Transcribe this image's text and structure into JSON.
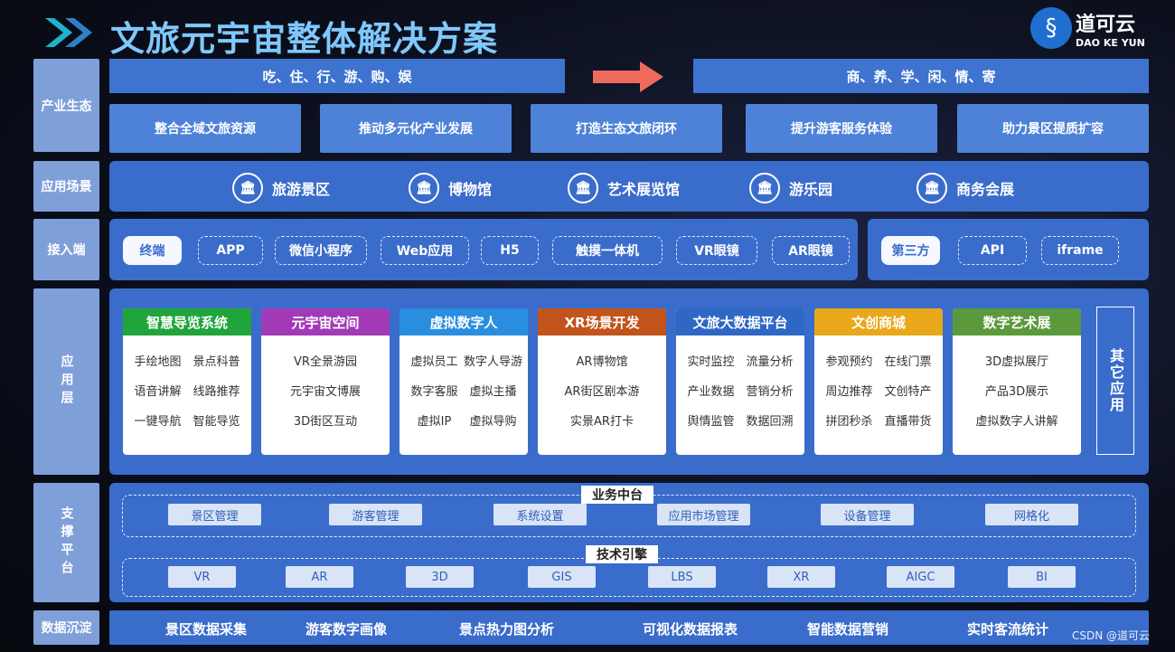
{
  "header": {
    "title": "文旅元宇宙整体解决方案",
    "logo_name": "道可云",
    "logo_sub": "DAO KE YUN"
  },
  "rows": {
    "industry": "产业生态",
    "scene": "应用场景",
    "access": "接入端",
    "app": "应用层",
    "support": "支撑平台",
    "data": "数据沉淀"
  },
  "industry": {
    "left": "吃、住、行、游、购、娱",
    "right": "商、养、学、闲、情、寄",
    "boxes": [
      "整合全域文旅资源",
      "推动多元化产业发展",
      "打造生态文旅闭环",
      "提升游客服务体验",
      "助力景区提质扩容"
    ]
  },
  "scenes": [
    "旅游景区",
    "博物馆",
    "艺术展览馆",
    "游乐园",
    "商务会展"
  ],
  "access": {
    "terminal_label": "终端",
    "terminals": [
      "APP",
      "微信小程序",
      "Web应用",
      "H5",
      "触摸一体机",
      "VR眼镜",
      "AR眼镜"
    ],
    "third_label": "第三方",
    "third": [
      "API",
      "iframe"
    ]
  },
  "apps": [
    {
      "title": "智慧导览系统",
      "color": "#1fa53a",
      "items": [
        "手绘地图",
        "景点科普",
        "语音讲解",
        "线路推荐",
        "一键导航",
        "智能导览"
      ]
    },
    {
      "title": "元宇宙空间",
      "color": "#a23ab8",
      "items": [
        "VR全景游园",
        "元宇宙文博展",
        "3D街区互动"
      ]
    },
    {
      "title": "虚拟数字人",
      "color": "#2a8ee0",
      "items": [
        "虚拟员工",
        "数字人导游",
        "数字客服",
        "虚拟主播",
        "虚拟IP",
        "虚拟导购"
      ]
    },
    {
      "title": "XR场景开发",
      "color": "#c2531a",
      "items": [
        "AR博物馆",
        "AR街区剧本游",
        "实景AR打卡"
      ]
    },
    {
      "title": "文旅大数据平台",
      "color": "#2f67c4",
      "items": [
        "实时监控",
        "流量分析",
        "产业数据",
        "营销分析",
        "舆情监管",
        "数据回溯"
      ]
    },
    {
      "title": "文创商城",
      "color": "#e8a81a",
      "items": [
        "参观预约",
        "在线门票",
        "周边推荐",
        "文创特产",
        "拼团秒杀",
        "直播带货"
      ]
    },
    {
      "title": "数字艺术展",
      "color": "#5b9a3c",
      "items": [
        "3D虚拟展厅",
        "产品3D展示",
        "虚拟数字人讲解"
      ]
    }
  ],
  "other_app": "其它应用",
  "support": {
    "business_title": "业务中台",
    "business": [
      "景区管理",
      "游客管理",
      "系统设置",
      "应用市场管理",
      "设备管理",
      "网格化"
    ],
    "tech_title": "技术引擎",
    "tech": [
      "VR",
      "AR",
      "3D",
      "GIS",
      "LBS",
      "XR",
      "AIGC",
      "BI"
    ]
  },
  "data_items": [
    "景区数据采集",
    "游客数字画像",
    "景点热力图分析",
    "可视化数据报表",
    "智能数据营销",
    "实时客流统计"
  ],
  "watermark": "CSDN @道可云",
  "colors": {
    "panel": "#3a6ccb",
    "label": "#7f9fd9",
    "arrow": "#f06a5c",
    "title": "#7fc8ff"
  }
}
